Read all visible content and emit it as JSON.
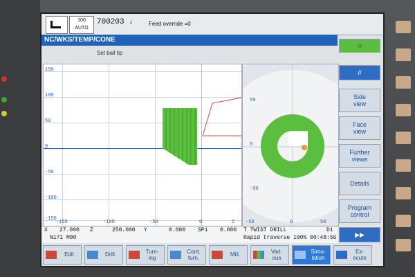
{
  "status": {
    "mode_top": "100",
    "mode_bottom": "AUTO",
    "program_number": "700203",
    "message": "Feed override =0"
  },
  "path": "NC/WKS/TEMP/CONE",
  "subtitle": "Set ball tip",
  "softkeys_right": [
    {
      "label": "",
      "icon": "diamond-icon"
    },
    {
      "label": "//",
      "icon": "slash-icon"
    },
    {
      "label": "Side\nview"
    },
    {
      "label": "Face\nview"
    },
    {
      "label": "Further\nviews"
    },
    {
      "label": "Details"
    },
    {
      "label": "Program\ncontrol"
    },
    {
      "label": "",
      "icon": "double-arrow-icon"
    }
  ],
  "graph_left": {
    "y_ticks": [
      "150",
      "100",
      "50",
      "0",
      "-50",
      "-100",
      "-150"
    ],
    "x_ticks": [
      "-150",
      "-100",
      "-50",
      "0"
    ],
    "x_axis_label": "Z"
  },
  "graph_right": {
    "y_ticks": [
      "50",
      "0",
      "-50"
    ],
    "x_ticks": [
      "-50",
      "0",
      "50"
    ]
  },
  "coords": {
    "x_label": "X",
    "x_value": "27.000",
    "z_label": "Z",
    "z_value": "250.000",
    "y_label": "Y",
    "y_value": "0.000",
    "sp_label": "SP1",
    "sp_value": "0.000",
    "tool": "T TWIST DRILL",
    "tool_d": "D1",
    "block": "N171  M00",
    "rapid": "Rapid traverse 100% 00:48:56"
  },
  "softkeys_bottom": [
    {
      "label": "Edit",
      "icon": "edit-icon"
    },
    {
      "label": "Drill.",
      "icon": "drill-icon"
    },
    {
      "label": "Turn-\ning",
      "icon": "turning-icon"
    },
    {
      "label": "Cont.\nturn.",
      "icon": "contour-icon"
    },
    {
      "label": "Mill.",
      "icon": "mill-icon"
    },
    {
      "label": "Vari-\nous",
      "icon": "various-icon"
    },
    {
      "label": "Simu-\nlation",
      "icon": "simulation-icon"
    },
    {
      "label": "Ex-\necute",
      "icon": "execute-icon"
    }
  ],
  "colors": {
    "accent": "#1f64b8",
    "green": "#5cbe3e",
    "path_red": "#d2483a"
  }
}
